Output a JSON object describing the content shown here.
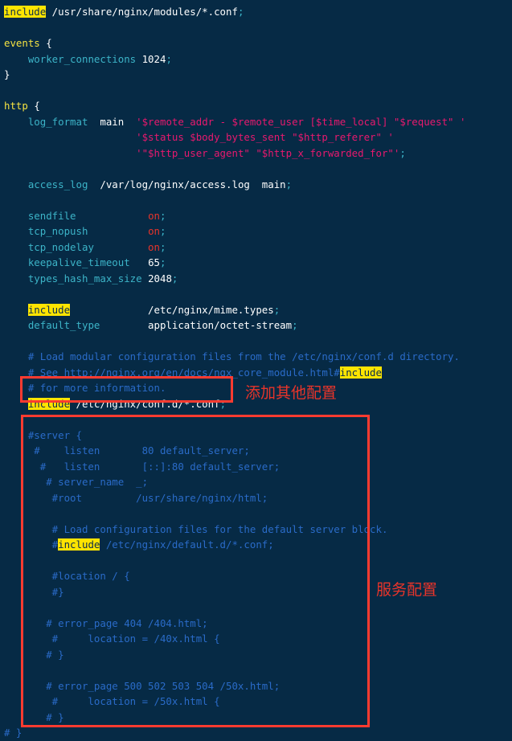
{
  "editor": {
    "background_color": "#062a45",
    "filename_context": "nginx.conf",
    "lines": [
      {
        "id": "l1",
        "segments": [
          {
            "t": "include",
            "c": "hl"
          },
          {
            "t": " /usr/share/nginx/modules/*.conf",
            "c": "val"
          },
          {
            "t": ";",
            "c": "semi"
          }
        ]
      },
      {
        "id": "l2",
        "segments": []
      },
      {
        "id": "l3",
        "segments": [
          {
            "t": "events",
            "c": "kw"
          },
          {
            "t": " ",
            "c": "val"
          },
          {
            "t": "{",
            "c": "brace"
          }
        ]
      },
      {
        "id": "l4",
        "segments": [
          {
            "t": "    ",
            "c": "val"
          },
          {
            "t": "worker_connections",
            "c": "dir"
          },
          {
            "t": " ",
            "c": "val"
          },
          {
            "t": "1024",
            "c": "num"
          },
          {
            "t": ";",
            "c": "semi"
          }
        ]
      },
      {
        "id": "l5",
        "segments": [
          {
            "t": "}",
            "c": "brace"
          }
        ]
      },
      {
        "id": "l6",
        "segments": []
      },
      {
        "id": "l7",
        "segments": [
          {
            "t": "http",
            "c": "kw"
          },
          {
            "t": " ",
            "c": "val"
          },
          {
            "t": "{",
            "c": "brace"
          }
        ]
      },
      {
        "id": "l8",
        "segments": [
          {
            "t": "    ",
            "c": "val"
          },
          {
            "t": "log_format",
            "c": "dir"
          },
          {
            "t": "  ",
            "c": "val"
          },
          {
            "t": "main",
            "c": "val"
          },
          {
            "t": "  ",
            "c": "val"
          },
          {
            "t": "'$remote_addr - $remote_user [$time_local] \"$request\" '",
            "c": "str"
          }
        ]
      },
      {
        "id": "l9",
        "segments": [
          {
            "t": "                      ",
            "c": "val"
          },
          {
            "t": "'$status $body_bytes_sent \"$http_referer\" '",
            "c": "str"
          }
        ]
      },
      {
        "id": "l10",
        "segments": [
          {
            "t": "                      ",
            "c": "val"
          },
          {
            "t": "'\"$http_user_agent\" \"$http_x_forwarded_for\"'",
            "c": "str"
          },
          {
            "t": ";",
            "c": "semi"
          }
        ]
      },
      {
        "id": "l11",
        "segments": []
      },
      {
        "id": "l12",
        "segments": [
          {
            "t": "    ",
            "c": "val"
          },
          {
            "t": "access_log",
            "c": "dir"
          },
          {
            "t": "  /var/log/nginx/access.log  main",
            "c": "val"
          },
          {
            "t": ";",
            "c": "semi"
          }
        ]
      },
      {
        "id": "l13",
        "segments": []
      },
      {
        "id": "l14",
        "segments": [
          {
            "t": "    ",
            "c": "val"
          },
          {
            "t": "sendfile",
            "c": "dir"
          },
          {
            "t": "            ",
            "c": "val"
          },
          {
            "t": "on",
            "c": "on"
          },
          {
            "t": ";",
            "c": "semi"
          }
        ]
      },
      {
        "id": "l15",
        "segments": [
          {
            "t": "    ",
            "c": "val"
          },
          {
            "t": "tcp_nopush",
            "c": "dir"
          },
          {
            "t": "          ",
            "c": "val"
          },
          {
            "t": "on",
            "c": "on"
          },
          {
            "t": ";",
            "c": "semi"
          }
        ]
      },
      {
        "id": "l16",
        "segments": [
          {
            "t": "    ",
            "c": "val"
          },
          {
            "t": "tcp_nodelay",
            "c": "dir"
          },
          {
            "t": "         ",
            "c": "val"
          },
          {
            "t": "on",
            "c": "on"
          },
          {
            "t": ";",
            "c": "semi"
          }
        ]
      },
      {
        "id": "l17",
        "segments": [
          {
            "t": "    ",
            "c": "val"
          },
          {
            "t": "keepalive_timeout",
            "c": "dir"
          },
          {
            "t": "   ",
            "c": "val"
          },
          {
            "t": "65",
            "c": "num"
          },
          {
            "t": ";",
            "c": "semi"
          }
        ]
      },
      {
        "id": "l18",
        "segments": [
          {
            "t": "    ",
            "c": "val"
          },
          {
            "t": "types_hash_max_size",
            "c": "dir"
          },
          {
            "t": " ",
            "c": "val"
          },
          {
            "t": "2048",
            "c": "num"
          },
          {
            "t": ";",
            "c": "semi"
          }
        ]
      },
      {
        "id": "l19",
        "segments": []
      },
      {
        "id": "l20",
        "segments": [
          {
            "t": "    ",
            "c": "val"
          },
          {
            "t": "include",
            "c": "hl"
          },
          {
            "t": "             /etc/nginx/mime.types",
            "c": "val"
          },
          {
            "t": ";",
            "c": "semi"
          }
        ]
      },
      {
        "id": "l21",
        "segments": [
          {
            "t": "    ",
            "c": "val"
          },
          {
            "t": "default_type",
            "c": "dir"
          },
          {
            "t": "        application/octet-stream",
            "c": "val"
          },
          {
            "t": ";",
            "c": "semi"
          }
        ]
      },
      {
        "id": "l22",
        "segments": []
      },
      {
        "id": "l23",
        "segments": [
          {
            "t": "    # Load modular configuration files from the /etc/nginx/conf.d directory.",
            "c": "cmt"
          }
        ]
      },
      {
        "id": "l24",
        "segments": [
          {
            "t": "    # See http://nginx.org/en/docs/ngx_core_module.html#",
            "c": "cmt"
          },
          {
            "t": "include",
            "c": "hl"
          }
        ]
      },
      {
        "id": "l25",
        "segments": [
          {
            "t": "    # for more information.",
            "c": "cmt"
          }
        ]
      },
      {
        "id": "l26",
        "segments": [
          {
            "t": "    ",
            "c": "val"
          },
          {
            "t": "include",
            "c": "hl"
          },
          {
            "t": " /etc/nginx/conf.d/*.conf",
            "c": "val"
          },
          {
            "t": ";",
            "c": "semi"
          }
        ]
      },
      {
        "id": "l27",
        "segments": []
      },
      {
        "id": "l28",
        "segments": [
          {
            "t": "    #server {",
            "c": "cmt"
          }
        ]
      },
      {
        "id": "l29",
        "segments": [
          {
            "t": "     #    listen       80 default_server;",
            "c": "cmt"
          }
        ]
      },
      {
        "id": "l30",
        "segments": [
          {
            "t": "      #   listen       [::]:80 default_server;",
            "c": "cmt"
          }
        ]
      },
      {
        "id": "l31",
        "segments": [
          {
            "t": "       # server_name  _;",
            "c": "cmt"
          }
        ]
      },
      {
        "id": "l32",
        "segments": [
          {
            "t": "        #root         /usr/share/nginx/html;",
            "c": "cmt"
          }
        ]
      },
      {
        "id": "l33",
        "segments": []
      },
      {
        "id": "l34",
        "segments": [
          {
            "t": "        # Load configuration files for the default server block.",
            "c": "cmt"
          }
        ]
      },
      {
        "id": "l35",
        "segments": [
          {
            "t": "        #",
            "c": "cmt"
          },
          {
            "t": "include",
            "c": "hl"
          },
          {
            "t": " /etc/nginx/default.d/*.conf;",
            "c": "cmt"
          }
        ]
      },
      {
        "id": "l36",
        "segments": []
      },
      {
        "id": "l37",
        "segments": [
          {
            "t": "        #location / {",
            "c": "cmt"
          }
        ]
      },
      {
        "id": "l38",
        "segments": [
          {
            "t": "        #}",
            "c": "cmt"
          }
        ]
      },
      {
        "id": "l39",
        "segments": []
      },
      {
        "id": "l40",
        "segments": [
          {
            "t": "       # error_page 404 /404.html;",
            "c": "cmt"
          }
        ]
      },
      {
        "id": "l41",
        "segments": [
          {
            "t": "        #     location = /40x.html {",
            "c": "cmt"
          }
        ]
      },
      {
        "id": "l42",
        "segments": [
          {
            "t": "       # }",
            "c": "cmt"
          }
        ]
      },
      {
        "id": "l43",
        "segments": []
      },
      {
        "id": "l44",
        "segments": [
          {
            "t": "       # error_page 500 502 503 504 /50x.html;",
            "c": "cmt"
          }
        ]
      },
      {
        "id": "l45",
        "segments": [
          {
            "t": "        #     location = /50x.html {",
            "c": "cmt"
          }
        ]
      },
      {
        "id": "l46",
        "segments": [
          {
            "t": "       # }",
            "c": "cmt"
          }
        ]
      },
      {
        "id": "l47",
        "segments": [
          {
            "t": "# }",
            "c": "cmt"
          }
        ]
      }
    ]
  },
  "annotations": {
    "color": "#e8342a",
    "include_label": "添加其他配置",
    "server_label": "服务配置"
  }
}
